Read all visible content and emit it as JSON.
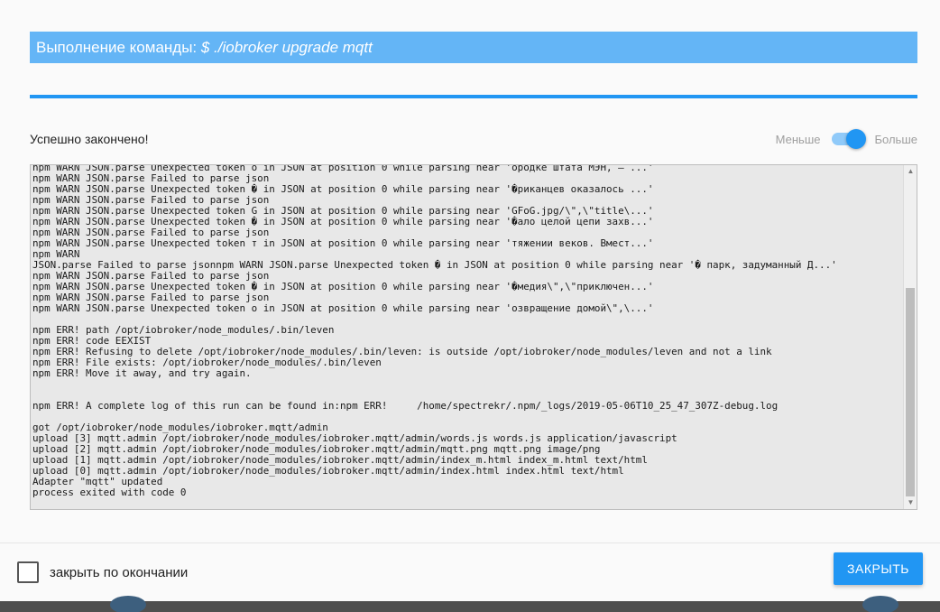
{
  "dialog": {
    "title_prefix": "Выполнение команды: ",
    "title_command": "$ ./iobroker upgrade mqtt",
    "progress_percent": 100,
    "status": "Успешно закончено!",
    "toggle": {
      "less_label": "Меньше",
      "more_label": "Больше",
      "state": "more"
    },
    "log_lines": [
      "npm WARN JSON.parse Unexpected token о in JSON at position 0 while parsing near 'ородке штата МЭН, — ...'",
      "npm WARN JSON.parse Failed to parse json",
      "npm WARN JSON.parse Unexpected token � in JSON at position 0 while parsing near '�риканцев оказалось ...'",
      "npm WARN JSON.parse Failed to parse json",
      "npm WARN JSON.parse Unexpected token G in JSON at position 0 while parsing near 'GFoG.jpg/\\\",\\\"title\\...'",
      "npm WARN JSON.parse Unexpected token � in JSON at position 0 while parsing near '�ало целой цепи захв...'",
      "npm WARN JSON.parse Failed to parse json",
      "npm WARN JSON.parse Unexpected token т in JSON at position 0 while parsing near 'тяжении веков. Вмест...'",
      "npm WARN",
      "JSON.parse Failed to parse jsonnpm WARN JSON.parse Unexpected token � in JSON at position 0 while parsing near '� парк, задуманный Д...'",
      "npm WARN JSON.parse Failed to parse json",
      "npm WARN JSON.parse Unexpected token � in JSON at position 0 while parsing near '�медия\\\",\\\"приключен...'",
      "npm WARN JSON.parse Failed to parse json",
      "npm WARN JSON.parse Unexpected token о in JSON at position 0 while parsing near 'озвращение домой\\\",\\...'",
      "",
      "npm ERR! path /opt/iobroker/node_modules/.bin/leven",
      "npm ERR! code EEXIST",
      "npm ERR! Refusing to delete /opt/iobroker/node_modules/.bin/leven: is outside /opt/iobroker/node_modules/leven and not a link",
      "npm ERR! File exists: /opt/iobroker/node_modules/.bin/leven",
      "npm ERR! Move it away, and try again.",
      "",
      "",
      "npm ERR! A complete log of this run can be found in:npm ERR!     /home/spectrekr/.npm/_logs/2019-05-06T10_25_47_307Z-debug.log",
      "",
      "got /opt/iobroker/node_modules/iobroker.mqtt/admin",
      "upload [3] mqtt.admin /opt/iobroker/node_modules/iobroker.mqtt/admin/words.js words.js application/javascript",
      "upload [2] mqtt.admin /opt/iobroker/node_modules/iobroker.mqtt/admin/mqtt.png mqtt.png image/png",
      "upload [1] mqtt.admin /opt/iobroker/node_modules/iobroker.mqtt/admin/index_m.html index_m.html text/html",
      "upload [0] mqtt.admin /opt/iobroker/node_modules/iobroker.mqtt/admin/index.html index.html text/html",
      "Adapter \"mqtt\" updated",
      "process exited with code 0"
    ],
    "footer": {
      "close_on_finish_label": "закрыть по окончании",
      "close_on_finish_checked": false,
      "close_button_label": "ЗАКРЫТЬ"
    }
  },
  "colors": {
    "title_bg": "#64b5f6",
    "accent": "#2196f3"
  }
}
